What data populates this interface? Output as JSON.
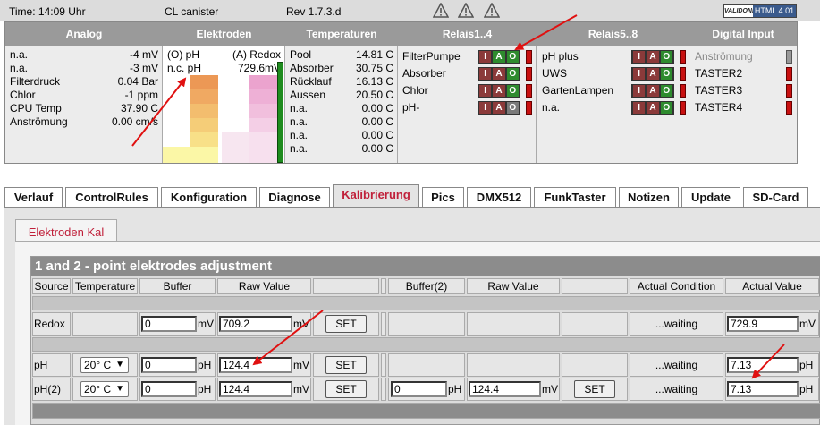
{
  "topbar": {
    "time": "Time: 14:09 Uhr",
    "device": "CL canister",
    "rev": "Rev 1.7.3.d",
    "validator_left": "VALIDONE",
    "validator_right": "HTML 4.01"
  },
  "panel": {
    "headers": {
      "analog": "Analog",
      "elektroden": "Elektroden",
      "temperaturen": "Temperaturen",
      "relais1": "Relais1..4",
      "relais5": "Relais5..8",
      "digital": "Digital Input"
    },
    "analog": [
      {
        "label": "n.a.",
        "value": "-4 mV"
      },
      {
        "label": "n.a.",
        "value": "-3 mV"
      },
      {
        "label": "Filterdruck",
        "value": "0.04 Bar"
      },
      {
        "label": "Chlor",
        "value": "-1 ppm"
      },
      {
        "label": "CPU Temp",
        "value": "37.90 C"
      },
      {
        "label": "Anströmung",
        "value": "0.00 cm/s"
      }
    ],
    "elektroden": {
      "ph_label": "(O) pH",
      "redox_label": "(A) Redox",
      "ph_value": "n.c. pH",
      "redox_value": "729.6mV"
    },
    "temperaturen": [
      {
        "label": "Pool",
        "value": "14.81 C"
      },
      {
        "label": "Absorber",
        "value": "30.75 C"
      },
      {
        "label": "Rücklauf",
        "value": "16.13 C"
      },
      {
        "label": "Aussen",
        "value": "20.50 C"
      },
      {
        "label": "n.a.",
        "value": "0.00 C"
      },
      {
        "label": "n.a.",
        "value": "0.00 C"
      },
      {
        "label": "n.a.",
        "value": "0.00 C"
      },
      {
        "label": "n.a.",
        "value": "0.00 C"
      }
    ],
    "relais1": [
      {
        "label": "FilterPumpe"
      },
      {
        "label": "Absorber"
      },
      {
        "label": "Chlor"
      },
      {
        "label": "pH-"
      }
    ],
    "relais5": [
      {
        "label": "pH plus"
      },
      {
        "label": "UWS"
      },
      {
        "label": "GartenLampen"
      },
      {
        "label": "n.a."
      }
    ],
    "digital": [
      {
        "label": "Anströmung"
      },
      {
        "label": "TASTER2"
      },
      {
        "label": "TASTER3"
      },
      {
        "label": "TASTER4"
      }
    ],
    "iao": {
      "i": "I",
      "a": "A",
      "o": "O"
    }
  },
  "tabs": [
    "Verlauf",
    "ControlRules",
    "Konfiguration",
    "Diagnose",
    "Kalibrierung",
    "Pics",
    "DMX512",
    "FunkTaster",
    "Notizen",
    "Update",
    "SD-Card"
  ],
  "active_tab": "Kalibrierung",
  "subtab": "Elektroden Kal",
  "table": {
    "title": "1 and 2 - point elektrodes adjustment",
    "headers": {
      "source": "Source",
      "temperature": "Temperature",
      "buffer": "Buffer",
      "raw": "Raw Value",
      "buffer2": "Buffer(2)",
      "raw2": "Raw Value",
      "cond": "Actual Condition",
      "actual": "Actual Value"
    },
    "rows": {
      "redox": {
        "label": "Redox",
        "buffer": "0",
        "buffer_unit": "mV",
        "raw": "709.2",
        "raw_unit": "mV",
        "set": "SET",
        "cond": "...waiting",
        "actual": "729.9",
        "actual_unit": "mV"
      },
      "ph": {
        "label": "pH",
        "temp": "20° C",
        "buffer": "0",
        "buffer_unit": "pH",
        "raw": "124.4",
        "raw_unit": "mV",
        "set": "SET",
        "cond": "...waiting",
        "actual": "7.13",
        "actual_unit": "pH"
      },
      "ph2": {
        "label": "pH(2)",
        "temp": "20° C",
        "buffer": "0",
        "buffer_unit": "pH",
        "raw": "124.4",
        "raw_unit": "mV",
        "set": "SET",
        "buffer2": "0",
        "buffer2_unit": "pH",
        "raw2": "124.4",
        "raw2_unit": "mV",
        "set2": "SET",
        "cond": "...waiting",
        "actual": "7.13",
        "actual_unit": "pH"
      }
    }
  },
  "colors": {
    "accent": "#c0203a",
    "arrow": "#e01010",
    "relay_on": "#2e8b2e",
    "led": "#c81010"
  }
}
